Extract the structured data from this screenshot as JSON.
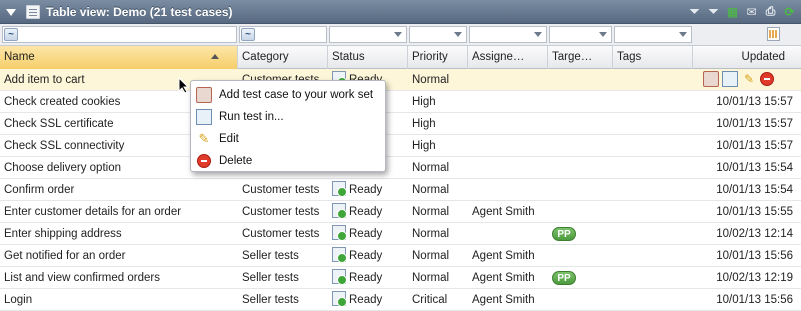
{
  "window": {
    "title": "Table view: Demo (21 test cases)"
  },
  "toolbar": {
    "tools": [
      {
        "icon": "filter-clear-icon",
        "glyph": "⏷"
      },
      {
        "icon": "filter-icon",
        "glyph": "⏷"
      },
      {
        "icon": "export-excel-icon",
        "glyph": "▦"
      },
      {
        "icon": "email-icon",
        "glyph": "✉"
      },
      {
        "icon": "print-icon",
        "glyph": "⎙"
      },
      {
        "icon": "refresh-icon",
        "glyph": "⟳"
      }
    ]
  },
  "filters": {
    "tilde": "~"
  },
  "columns": [
    {
      "key": "name",
      "label": "Name"
    },
    {
      "key": "category",
      "label": "Category"
    },
    {
      "key": "status",
      "label": "Status"
    },
    {
      "key": "priority",
      "label": "Priority"
    },
    {
      "key": "assignee",
      "label": "Assigne…"
    },
    {
      "key": "target",
      "label": "Targe…"
    },
    {
      "key": "tags",
      "label": "Tags"
    },
    {
      "key": "updated",
      "label": "Updated"
    }
  ],
  "rows": [
    {
      "name": "Add item to cart",
      "category": "Customer tests",
      "status": "Ready",
      "priority": "Normal",
      "assignee": "",
      "target": "",
      "updated": ""
    },
    {
      "name": "Check created cookies",
      "category": "",
      "status": "",
      "priority": "High",
      "assignee": "",
      "target": "",
      "updated": "10/01/13 15:57"
    },
    {
      "name": "Check SSL certificate",
      "category": "",
      "status": "",
      "priority": "High",
      "assignee": "",
      "target": "",
      "updated": "10/01/13 15:57"
    },
    {
      "name": "Check SSL connectivity",
      "category": "",
      "status": "",
      "priority": "High",
      "assignee": "",
      "target": "",
      "updated": "10/01/13 15:57"
    },
    {
      "name": "Choose delivery option",
      "category": "",
      "status": "",
      "priority": "Normal",
      "assignee": "",
      "target": "",
      "updated": "10/01/13 15:54"
    },
    {
      "name": "Confirm order",
      "category": "Customer tests",
      "status": "Ready",
      "priority": "Normal",
      "assignee": "",
      "target": "",
      "updated": "10/01/13 15:54"
    },
    {
      "name": "Enter customer details for an order",
      "category": "Customer tests",
      "status": "Ready",
      "priority": "Normal",
      "assignee": "Agent Smith",
      "target": "",
      "updated": "10/01/13 15:55"
    },
    {
      "name": "Enter shipping address",
      "category": "Customer tests",
      "status": "Ready",
      "priority": "Normal",
      "assignee": "",
      "target": "PP",
      "updated": "10/02/13 12:14"
    },
    {
      "name": "Get notified for an order",
      "category": "Seller tests",
      "status": "Ready",
      "priority": "Normal",
      "assignee": "Agent Smith",
      "target": "",
      "updated": "10/01/13 15:56"
    },
    {
      "name": "List and view confirmed orders",
      "category": "Seller tests",
      "status": "Ready",
      "priority": "Normal",
      "assignee": "Agent Smith",
      "target": "PP",
      "updated": "10/02/13 12:19"
    },
    {
      "name": "Login",
      "category": "Seller tests",
      "status": "Ready",
      "priority": "Critical",
      "assignee": "Agent Smith",
      "target": "",
      "updated": "10/01/13 15:56"
    }
  ],
  "context_menu": {
    "items": [
      {
        "label": "Add test case to your work set",
        "icon": "workset-icon"
      },
      {
        "label": "Run test in...",
        "icon": "run-icon"
      },
      {
        "label": "Edit",
        "icon": "edit-icon"
      },
      {
        "label": "Delete",
        "icon": "delete-icon"
      }
    ]
  }
}
